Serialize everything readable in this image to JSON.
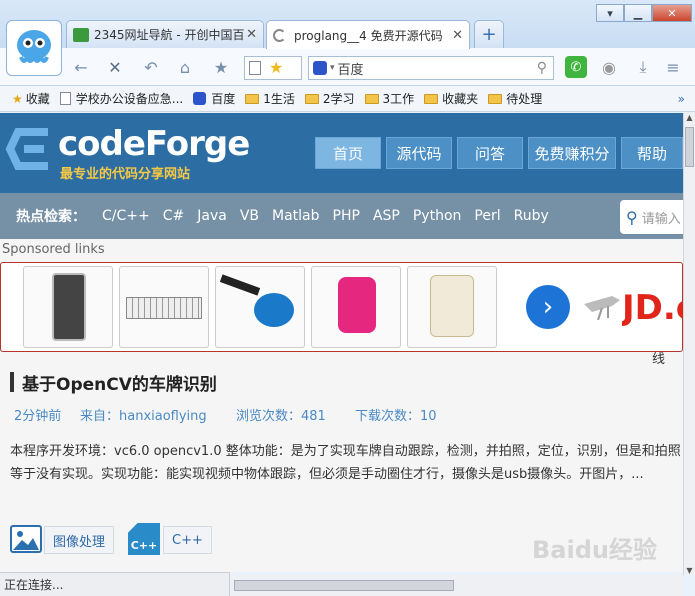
{
  "tabs": [
    {
      "label": "2345网址导航 - 开创中国百"
    },
    {
      "label": "proglang__4 免费开源代码"
    }
  ],
  "window_buttons": {
    "minimize": "▁",
    "maximize": "☐",
    "close": "✕"
  },
  "search": {
    "engine_label": "百度"
  },
  "bookmarks": [
    {
      "label": "收藏"
    },
    {
      "label": "学校办公设备应急..."
    },
    {
      "label": "百度"
    },
    {
      "label": "1生活"
    },
    {
      "label": "2学习"
    },
    {
      "label": "3工作"
    },
    {
      "label": "收藏夹"
    },
    {
      "label": "待处理"
    }
  ],
  "site": {
    "logo_text": "codeForge",
    "slogan": "最专业的代码分享网站",
    "nav": [
      "首页",
      "源代码",
      "问答",
      "免费赚积分",
      "帮助"
    ],
    "hot_label": "热点检索：",
    "hot_items": [
      "C/C++",
      "C#",
      "Java",
      "VB",
      "Matlab",
      "PHP",
      "ASP",
      "Python",
      "Perl",
      "Ruby"
    ],
    "search_placeholder": "请输入",
    "sponsored": "Sponsored links",
    "ad_brand": "JD.co",
    "side_text": "线"
  },
  "article": {
    "title": "基于OpenCV的车牌识别",
    "time": "2分钟前",
    "source": "来自：hanxiaoflying",
    "views": "浏览次数：481",
    "downloads": "下载次数：10",
    "desc": "本程序开发环境：vc6.0 opencv1.0 整体功能：是为了实现车牌自动跟踪，检测，并拍照，定位，识别，但是和拍照等于没有实现。实现功能：能实现视频中物体跟踪，但必须是手动圈住才行，摄像头是usb摄像头。开图片，...",
    "tags": [
      "图像处理",
      "C++"
    ],
    "cpp_icon_text": "C++"
  },
  "status": "正在连接...",
  "watermark": "Baidu经验",
  "colors": {
    "accent": "#2c6ea4",
    "ad_border": "#b7332b"
  }
}
